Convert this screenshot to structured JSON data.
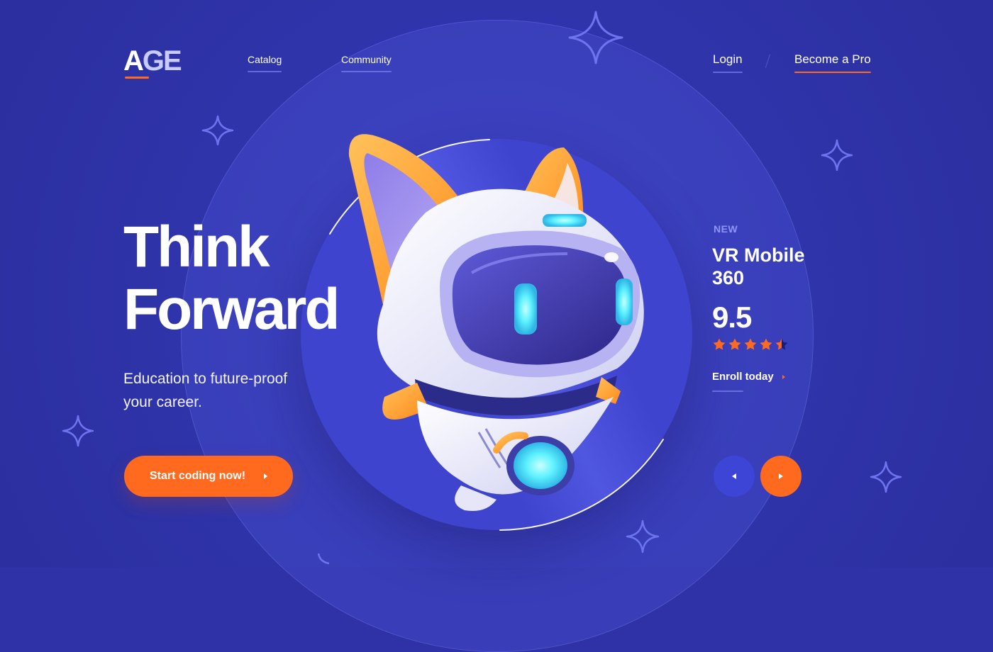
{
  "brand": {
    "logo_main": "A",
    "logo_rest": "GE"
  },
  "nav": {
    "items": [
      {
        "label": "Catalog"
      },
      {
        "label": "Community"
      }
    ],
    "login_label": "Login",
    "become_pro_label": "Become a Pro"
  },
  "hero": {
    "headline_line1": "Think",
    "headline_line2": "Forward",
    "subtitle_line1": "Education to future-proof",
    "subtitle_line2": "your career.",
    "cta_label": "Start coding now!"
  },
  "product": {
    "badge": "NEW",
    "title_line1": "VR Mobile",
    "title_line2": "360",
    "rating": "9.5",
    "stars": 4.5,
    "enroll_label": "Enroll today"
  },
  "icons": {
    "prev": "arrow-left-icon",
    "next": "arrow-right-icon",
    "decoration": "sparkle-icon",
    "illustration": "robot-cat-mascot"
  },
  "colors": {
    "background": "#2e32a6",
    "accent": "#ff6a1f",
    "secondary": "#3d45d6",
    "badge": "#8f95ff",
    "screen_glow": "#5ff2ff"
  }
}
